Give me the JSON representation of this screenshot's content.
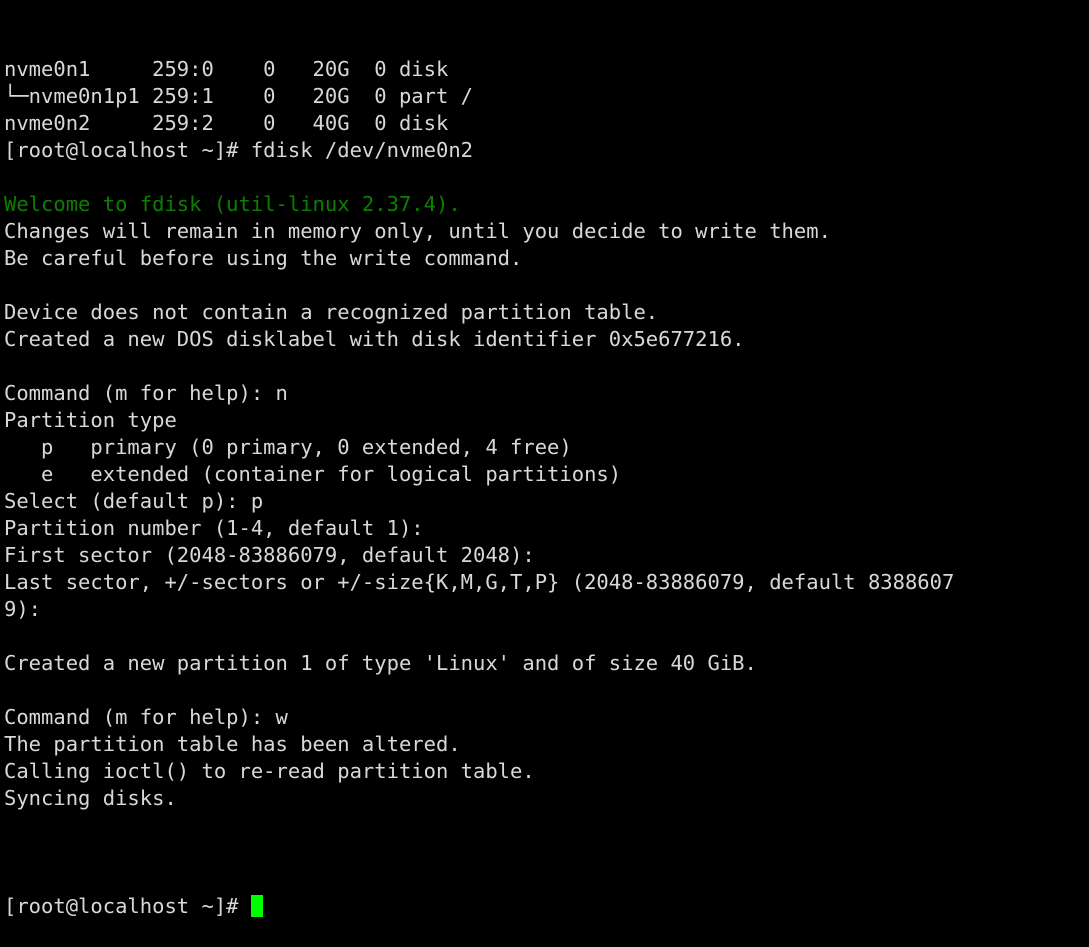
{
  "terminal": {
    "background_color": "#000000",
    "text_color": "#d8d8d8",
    "accent_green": "#0b8000",
    "cursor_color": "#00ff00",
    "lines": [
      {
        "id": "lsblk-row-nvme0n1",
        "text": "nvme0n1     259:0    0   20G  0 disk ",
        "color": "default"
      },
      {
        "id": "lsblk-row-nvme0n1p1",
        "text": "└─nvme0n1p1 259:1    0   20G  0 part /",
        "color": "default"
      },
      {
        "id": "lsblk-row-nvme0n2",
        "text": "nvme0n2     259:2    0   40G  0 disk ",
        "color": "default"
      },
      {
        "id": "prompt-fdisk-command",
        "text": "[root@localhost ~]# fdisk /dev/nvme0n2",
        "color": "default"
      },
      {
        "id": "blank-1",
        "text": "",
        "color": "default"
      },
      {
        "id": "fdisk-welcome",
        "text": "Welcome to fdisk (util-linux 2.37.4).",
        "color": "green"
      },
      {
        "id": "fdisk-memory-notice",
        "text": "Changes will remain in memory only, until you decide to write them.",
        "color": "default"
      },
      {
        "id": "fdisk-careful-notice",
        "text": "Be careful before using the write command.",
        "color": "default"
      },
      {
        "id": "blank-2",
        "text": "",
        "color": "default"
      },
      {
        "id": "no-partition-table",
        "text": "Device does not contain a recognized partition table.",
        "color": "default"
      },
      {
        "id": "created-disklabel",
        "text": "Created a new DOS disklabel with disk identifier 0x5e677216.",
        "color": "default"
      },
      {
        "id": "blank-3",
        "text": "",
        "color": "default"
      },
      {
        "id": "command-prompt-n",
        "text": "Command (m for help): n",
        "color": "default"
      },
      {
        "id": "partition-type-header",
        "text": "Partition type",
        "color": "default"
      },
      {
        "id": "partition-type-p",
        "text": "   p   primary (0 primary, 0 extended, 4 free)",
        "color": "default"
      },
      {
        "id": "partition-type-e",
        "text": "   e   extended (container for logical partitions)",
        "color": "default"
      },
      {
        "id": "select-default-p",
        "text": "Select (default p): p",
        "color": "default"
      },
      {
        "id": "partition-number",
        "text": "Partition number (1-4, default 1): ",
        "color": "default"
      },
      {
        "id": "first-sector",
        "text": "First sector (2048-83886079, default 2048): ",
        "color": "default"
      },
      {
        "id": "last-sector-wrap-1",
        "text": "Last sector, +/-sectors or +/-size{K,M,G,T,P} (2048-83886079, default 8388607",
        "color": "default"
      },
      {
        "id": "last-sector-wrap-2",
        "text": "9): ",
        "color": "default"
      },
      {
        "id": "blank-4",
        "text": "",
        "color": "default"
      },
      {
        "id": "created-partition",
        "text": "Created a new partition 1 of type 'Linux' and of size 40 GiB.",
        "color": "default"
      },
      {
        "id": "blank-5",
        "text": "",
        "color": "default"
      },
      {
        "id": "command-prompt-w",
        "text": "Command (m for help): w",
        "color": "default"
      },
      {
        "id": "table-altered",
        "text": "The partition table has been altered.",
        "color": "default"
      },
      {
        "id": "calling-ioctl",
        "text": "Calling ioctl() to re-read partition table.",
        "color": "default"
      },
      {
        "id": "syncing-disks",
        "text": "Syncing disks.",
        "color": "default"
      },
      {
        "id": "blank-6",
        "text": "",
        "color": "default"
      }
    ],
    "final_prompt": "[root@localhost ~]# "
  }
}
